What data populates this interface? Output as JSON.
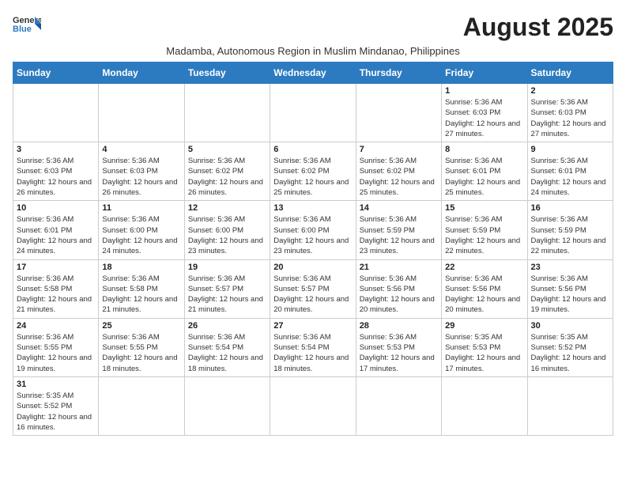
{
  "header": {
    "logo_general": "General",
    "logo_blue": "Blue",
    "month_title": "August 2025",
    "subtitle": "Madamba, Autonomous Region in Muslim Mindanao, Philippines"
  },
  "days_of_week": [
    "Sunday",
    "Monday",
    "Tuesday",
    "Wednesday",
    "Thursday",
    "Friday",
    "Saturday"
  ],
  "weeks": [
    [
      {
        "day": "",
        "info": ""
      },
      {
        "day": "",
        "info": ""
      },
      {
        "day": "",
        "info": ""
      },
      {
        "day": "",
        "info": ""
      },
      {
        "day": "",
        "info": ""
      },
      {
        "day": "1",
        "info": "Sunrise: 5:36 AM\nSunset: 6:03 PM\nDaylight: 12 hours\nand 27 minutes."
      },
      {
        "day": "2",
        "info": "Sunrise: 5:36 AM\nSunset: 6:03 PM\nDaylight: 12 hours\nand 27 minutes."
      }
    ],
    [
      {
        "day": "3",
        "info": "Sunrise: 5:36 AM\nSunset: 6:03 PM\nDaylight: 12 hours\nand 26 minutes."
      },
      {
        "day": "4",
        "info": "Sunrise: 5:36 AM\nSunset: 6:03 PM\nDaylight: 12 hours\nand 26 minutes."
      },
      {
        "day": "5",
        "info": "Sunrise: 5:36 AM\nSunset: 6:02 PM\nDaylight: 12 hours\nand 26 minutes."
      },
      {
        "day": "6",
        "info": "Sunrise: 5:36 AM\nSunset: 6:02 PM\nDaylight: 12 hours\nand 25 minutes."
      },
      {
        "day": "7",
        "info": "Sunrise: 5:36 AM\nSunset: 6:02 PM\nDaylight: 12 hours\nand 25 minutes."
      },
      {
        "day": "8",
        "info": "Sunrise: 5:36 AM\nSunset: 6:01 PM\nDaylight: 12 hours\nand 25 minutes."
      },
      {
        "day": "9",
        "info": "Sunrise: 5:36 AM\nSunset: 6:01 PM\nDaylight: 12 hours\nand 24 minutes."
      }
    ],
    [
      {
        "day": "10",
        "info": "Sunrise: 5:36 AM\nSunset: 6:01 PM\nDaylight: 12 hours\nand 24 minutes."
      },
      {
        "day": "11",
        "info": "Sunrise: 5:36 AM\nSunset: 6:00 PM\nDaylight: 12 hours\nand 24 minutes."
      },
      {
        "day": "12",
        "info": "Sunrise: 5:36 AM\nSunset: 6:00 PM\nDaylight: 12 hours\nand 23 minutes."
      },
      {
        "day": "13",
        "info": "Sunrise: 5:36 AM\nSunset: 6:00 PM\nDaylight: 12 hours\nand 23 minutes."
      },
      {
        "day": "14",
        "info": "Sunrise: 5:36 AM\nSunset: 5:59 PM\nDaylight: 12 hours\nand 23 minutes."
      },
      {
        "day": "15",
        "info": "Sunrise: 5:36 AM\nSunset: 5:59 PM\nDaylight: 12 hours\nand 22 minutes."
      },
      {
        "day": "16",
        "info": "Sunrise: 5:36 AM\nSunset: 5:59 PM\nDaylight: 12 hours\nand 22 minutes."
      }
    ],
    [
      {
        "day": "17",
        "info": "Sunrise: 5:36 AM\nSunset: 5:58 PM\nDaylight: 12 hours\nand 21 minutes."
      },
      {
        "day": "18",
        "info": "Sunrise: 5:36 AM\nSunset: 5:58 PM\nDaylight: 12 hours\nand 21 minutes."
      },
      {
        "day": "19",
        "info": "Sunrise: 5:36 AM\nSunset: 5:57 PM\nDaylight: 12 hours\nand 21 minutes."
      },
      {
        "day": "20",
        "info": "Sunrise: 5:36 AM\nSunset: 5:57 PM\nDaylight: 12 hours\nand 20 minutes."
      },
      {
        "day": "21",
        "info": "Sunrise: 5:36 AM\nSunset: 5:56 PM\nDaylight: 12 hours\nand 20 minutes."
      },
      {
        "day": "22",
        "info": "Sunrise: 5:36 AM\nSunset: 5:56 PM\nDaylight: 12 hours\nand 20 minutes."
      },
      {
        "day": "23",
        "info": "Sunrise: 5:36 AM\nSunset: 5:56 PM\nDaylight: 12 hours\nand 19 minutes."
      }
    ],
    [
      {
        "day": "24",
        "info": "Sunrise: 5:36 AM\nSunset: 5:55 PM\nDaylight: 12 hours\nand 19 minutes."
      },
      {
        "day": "25",
        "info": "Sunrise: 5:36 AM\nSunset: 5:55 PM\nDaylight: 12 hours\nand 18 minutes."
      },
      {
        "day": "26",
        "info": "Sunrise: 5:36 AM\nSunset: 5:54 PM\nDaylight: 12 hours\nand 18 minutes."
      },
      {
        "day": "27",
        "info": "Sunrise: 5:36 AM\nSunset: 5:54 PM\nDaylight: 12 hours\nand 18 minutes."
      },
      {
        "day": "28",
        "info": "Sunrise: 5:36 AM\nSunset: 5:53 PM\nDaylight: 12 hours\nand 17 minutes."
      },
      {
        "day": "29",
        "info": "Sunrise: 5:35 AM\nSunset: 5:53 PM\nDaylight: 12 hours\nand 17 minutes."
      },
      {
        "day": "30",
        "info": "Sunrise: 5:35 AM\nSunset: 5:52 PM\nDaylight: 12 hours\nand 16 minutes."
      }
    ],
    [
      {
        "day": "31",
        "info": "Sunrise: 5:35 AM\nSunset: 5:52 PM\nDaylight: 12 hours\nand 16 minutes."
      },
      {
        "day": "",
        "info": ""
      },
      {
        "day": "",
        "info": ""
      },
      {
        "day": "",
        "info": ""
      },
      {
        "day": "",
        "info": ""
      },
      {
        "day": "",
        "info": ""
      },
      {
        "day": "",
        "info": ""
      }
    ]
  ]
}
